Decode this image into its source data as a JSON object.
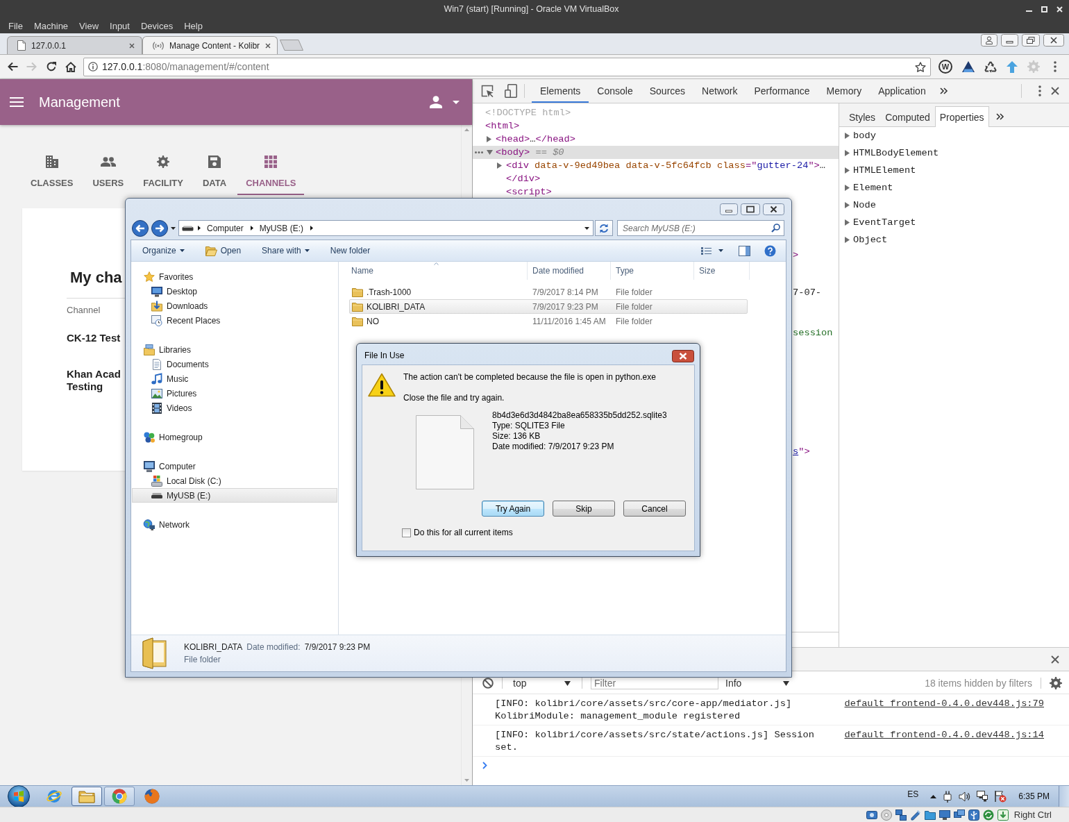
{
  "vbox": {
    "title": "Win7 (start) [Running] - Oracle VM VirtualBox",
    "menu": [
      "File",
      "Machine",
      "View",
      "Input",
      "Devices",
      "Help"
    ],
    "host_key": "Right Ctrl"
  },
  "browser": {
    "tabs": [
      {
        "title": "127.0.0.1",
        "kind": "page",
        "selected": false
      },
      {
        "title": "Manage Content - Kolibr",
        "kind": "broadcast",
        "selected": true
      }
    ],
    "forward_disabled": true,
    "url_host": "127.0.0.1",
    "url_path": ":8080/management/#/content",
    "extension_letter": "W"
  },
  "page": {
    "title": "Management",
    "nav": [
      {
        "label": "CLASSES",
        "kind": "building",
        "selected": false
      },
      {
        "label": "USERS",
        "kind": "users",
        "selected": false
      },
      {
        "label": "FACILITY",
        "kind": "gear",
        "selected": false
      },
      {
        "label": "DATA",
        "kind": "floppy",
        "selected": false
      },
      {
        "label": "CHANNELS",
        "kind": "grid",
        "selected": true
      }
    ],
    "heading": "My cha",
    "column_label": "Channel",
    "channels": [
      "CK-12 Test",
      "Khan Acad\nTesting"
    ]
  },
  "devtools": {
    "tabs": [
      {
        "label": "Elements",
        "selected": true
      },
      {
        "label": "Console",
        "selected": false
      },
      {
        "label": "Sources",
        "selected": false
      },
      {
        "label": "Network",
        "selected": false
      },
      {
        "label": "Performance",
        "selected": false
      },
      {
        "label": "Memory",
        "selected": false
      },
      {
        "label": "Application",
        "selected": false
      }
    ],
    "dom_tree": [
      {
        "selected": false,
        "segments": [
          {
            "text": "<!DOCTYPE html>",
            "kind": "doctype"
          }
        ]
      },
      {
        "selected": false,
        "segments": [
          {
            "text": "<html>",
            "kind": "tag"
          }
        ],
        "children": [
          {
            "selected": false,
            "expanded": false,
            "segments": [
              {
                "text": "<head>",
                "kind": "tag"
              },
              {
                "text": "…",
                "kind": "text"
              },
              {
                "text": "</head>",
                "kind": "tag"
              }
            ]
          },
          {
            "selected": true,
            "expanded": true,
            "segments": [
              {
                "text": "<body>",
                "kind": "tag"
              },
              {
                "text": " == $0",
                "kind": "hint"
              }
            ],
            "children": [
              {
                "selected": false,
                "expanded": false,
                "segments": [
                  {
                    "text": "<div",
                    "kind": "tag"
                  },
                  {
                    "text": " data-v-9ed49bea",
                    "kind": "attr"
                  },
                  {
                    "text": " data-v-5fc64fcb",
                    "kind": "attr"
                  },
                  {
                    "text": " class",
                    "kind": "attr"
                  },
                  {
                    "text": "=\"",
                    "kind": "tag"
                  },
                  {
                    "text": "gutter-24",
                    "kind": "value"
                  },
                  {
                    "text": "\">",
                    "kind": "tag"
                  },
                  {
                    "text": "…",
                    "kind": "text"
                  },
                  {
                    "text": "</div>",
                    "kind": "tag"
                  }
                ]
              },
              {
                "selected": false,
                "segments": [
                  {
                    "text": "<script>",
                    "kind": "tag"
                  }
                ]
              }
            ]
          }
        ]
      }
    ],
    "dom_fragments": [
      {
        "segments": [
          {
            "text": ">",
            "kind": "tag"
          }
        ]
      },
      {
        "segments": [
          {
            "text": "7-07-",
            "kind": "text"
          }
        ]
      },
      {
        "segments": [
          {
            "text": "session",
            "kind": "comment"
          }
        ]
      },
      {
        "segments": [
          {
            "text": "s",
            "kind": "link"
          },
          {
            "text": "\">",
            "kind": "tag"
          }
        ]
      }
    ],
    "sidebar_tabs": [
      {
        "label": "Styles",
        "selected": false
      },
      {
        "label": "Computed",
        "selected": false
      },
      {
        "label": "Properties",
        "selected": true
      }
    ],
    "properties": [
      {
        "name": "body",
        "expanded": false
      },
      {
        "name": "HTMLBodyElement",
        "expanded": false
      },
      {
        "name": "HTMLElement",
        "expanded": false
      },
      {
        "name": "Element",
        "expanded": false
      },
      {
        "name": "Node",
        "expanded": false
      },
      {
        "name": "EventTarget",
        "expanded": false
      },
      {
        "name": "Object",
        "expanded": false
      }
    ],
    "console": {
      "context": "top",
      "filter_placeholder": "Filter",
      "level": "Info",
      "hidden_note": "18 items hidden by filters",
      "messages": [
        {
          "text": "[INFO: kolibri/core/assets/src/core-app/mediator.js] KolibriModule: management_module registered",
          "source": "default_frontend-0.4.0.dev448.js:79"
        },
        {
          "text": "[INFO: kolibri/core/assets/src/state/actions.js] Session set.",
          "source": "default_frontend-0.4.0.dev448.js:14"
        }
      ]
    }
  },
  "explorer": {
    "breadcrumbs": [
      "Computer",
      "MyUSB (E:)"
    ],
    "search_placeholder": "Search MyUSB (E:)",
    "toolbar": [
      {
        "label": "Organize",
        "kind": "menu"
      },
      {
        "label": "Open",
        "kind": "open"
      },
      {
        "label": "Share with",
        "kind": "menu"
      },
      {
        "label": "New folder",
        "kind": "plain"
      }
    ],
    "nav": [
      {
        "label": "Favorites",
        "kind": "star",
        "selected": false,
        "children": [
          {
            "label": "Desktop",
            "kind": "desktop",
            "selected": false
          },
          {
            "label": "Downloads",
            "kind": "downloads",
            "selected": false
          },
          {
            "label": "Recent Places",
            "kind": "recent",
            "selected": false
          }
        ]
      },
      {
        "label": "Libraries",
        "kind": "libraries",
        "selected": false,
        "children": [
          {
            "label": "Documents",
            "kind": "documents",
            "selected": false
          },
          {
            "label": "Music",
            "kind": "music",
            "selected": false
          },
          {
            "label": "Pictures",
            "kind": "pictures",
            "selected": false
          },
          {
            "label": "Videos",
            "kind": "videos",
            "selected": false
          }
        ]
      },
      {
        "label": "Homegroup",
        "kind": "homegroup",
        "selected": false
      },
      {
        "label": "Computer",
        "kind": "computer",
        "selected": false,
        "children": [
          {
            "label": "Local Disk (C:)",
            "kind": "disk",
            "selected": false
          },
          {
            "label": "MyUSB (E:)",
            "kind": "usb",
            "selected": true
          }
        ]
      },
      {
        "label": "Network",
        "kind": "network",
        "selected": false
      }
    ],
    "columns": [
      "Name",
      "Date modified",
      "Type",
      "Size"
    ],
    "files": [
      {
        "name": ".Trash-1000",
        "date": "7/9/2017 8:14 PM",
        "type": "File folder",
        "selected": false
      },
      {
        "name": "KOLIBRI_DATA",
        "date": "7/9/2017 9:23 PM",
        "type": "File folder",
        "selected": true
      },
      {
        "name": "NO",
        "date": "11/11/2016 1:45 AM",
        "type": "File folder",
        "selected": false
      }
    ],
    "details": {
      "name": "KOLIBRI_DATA",
      "date_label": "Date modified:",
      "date": "7/9/2017 9:23 PM",
      "type": "File folder"
    }
  },
  "dialog": {
    "title": "File In Use",
    "message": "The action can't be completed because the file is open in python.exe",
    "instruction": "Close the file and try again.",
    "file_details": [
      "8b4d3e6d3d4842ba8ea658335b5dd252.sqlite3",
      "Type: SQLITE3 File",
      "Size: 136 KB",
      "Date modified: 7/9/2017 9:23 PM"
    ],
    "buttons": [
      {
        "label": "Try Again",
        "focused": true
      },
      {
        "label": "Skip",
        "focused": false
      },
      {
        "label": "Cancel",
        "focused": false
      }
    ],
    "apply_all": {
      "label": "Do this for all current items",
      "checked": false
    }
  },
  "taskbar": {
    "apps": [
      {
        "kind": "blue-globe",
        "running": false,
        "selected": false
      },
      {
        "kind": "folder",
        "running": true,
        "selected": true
      },
      {
        "kind": "tricolor",
        "running": true,
        "selected": false
      },
      {
        "kind": "orange-globe",
        "running": false,
        "selected": false
      }
    ],
    "language": "ES",
    "clock": "6:35 PM"
  }
}
